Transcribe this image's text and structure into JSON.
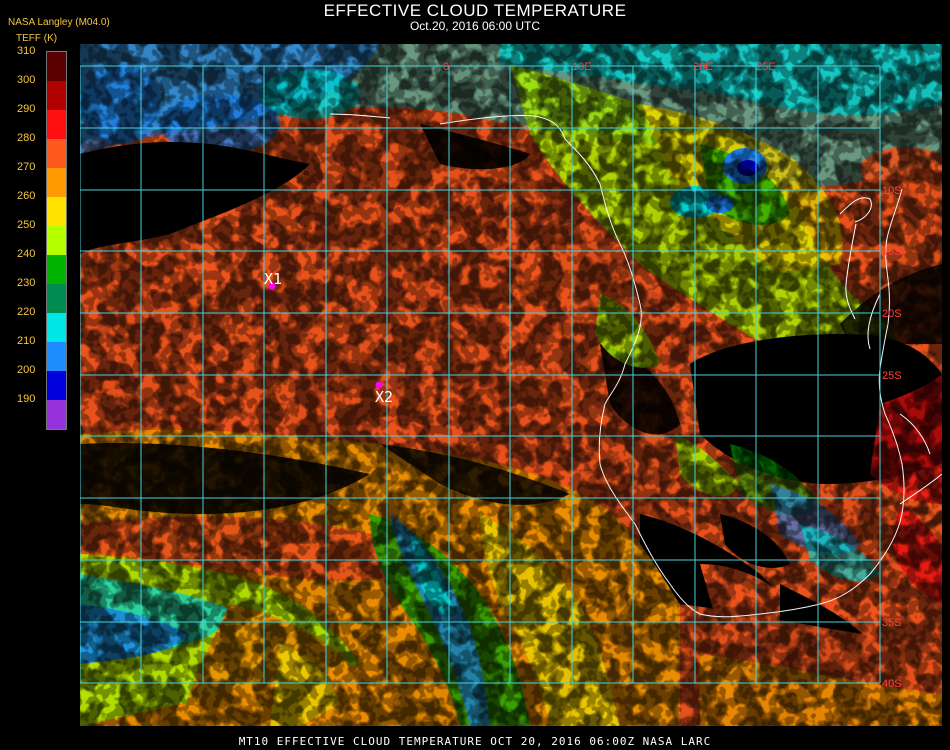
{
  "title": "EFFECTIVE CLOUD TEMPERATURE",
  "subtitle": "Oct.20, 2016 06:00 UTC",
  "org": "NASA Langley (M04.0)",
  "unit": "TEFF (K)",
  "footer": "MT10  EFFECTIVE CLOUD TEMPERATURE  OCT 20, 2016 06:00Z  NASA LARC",
  "colorbar": {
    "ticks": [
      "310",
      "300",
      "290",
      "280",
      "270",
      "260",
      "250",
      "240",
      "230",
      "220",
      "210",
      "200",
      "190"
    ],
    "colors": [
      "#5a0000",
      "#b00000",
      "#ff1010",
      "#ff5a1e",
      "#ff9a00",
      "#ffe200",
      "#b4ff00",
      "#00b400",
      "#008c50",
      "#00e6e6",
      "#1e8cff",
      "#0000dc",
      "#9632dc"
    ]
  },
  "grid": {
    "lon_labels": [
      "0",
      "10E",
      "20E",
      "25E"
    ],
    "lat_labels": [
      "10S",
      "15S",
      "20S",
      "25S",
      "35S",
      "40S"
    ]
  },
  "markers": [
    {
      "label": "X1",
      "color": "#ff00ff"
    },
    {
      "label": "X2",
      "color": "#ff00ff"
    }
  ]
}
